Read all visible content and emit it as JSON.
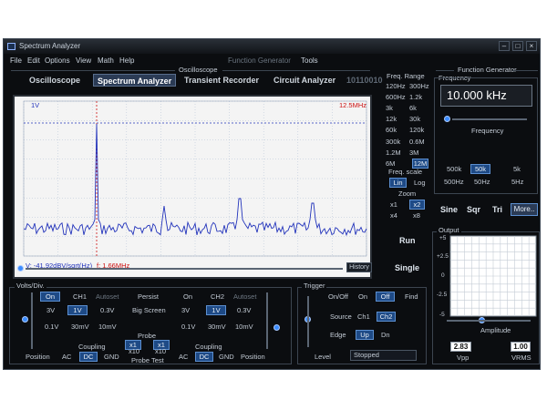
{
  "window": {
    "title": "Spectrum Analyzer",
    "min": "–",
    "max": "□",
    "close": "×"
  },
  "menu": {
    "file": "File",
    "edit": "Edit",
    "options": "Options",
    "view": "View",
    "math": "Math",
    "help": "Help",
    "function_generator": "Function Generator",
    "tools": "Tools"
  },
  "section_labels": {
    "oscilloscope": "Oscilloscope",
    "function_generator": "Function Generator",
    "frequency": "Frequency"
  },
  "tabs": {
    "oscilloscope": "Oscilloscope",
    "spectrum_analyzer": "Spectrum Analyzer",
    "transient_recorder": "Transient Recorder",
    "circuit_analyzer": "Circuit Analyzer",
    "binary": "10110010"
  },
  "display": {
    "top_left": "1V",
    "top_right": "12.5MHz",
    "cursor_readout": "V: -41.92dBV/sqrt(Hz)",
    "freq_readout": "f: 1.66MHz",
    "history": "History"
  },
  "freq_range": {
    "label": "Freq. Range",
    "options": [
      "120Hz",
      "300Hz",
      "600Hz",
      "1.2k",
      "3k",
      "6k",
      "12k",
      "30k",
      "60k",
      "120k",
      "300k",
      "0.6M",
      "1.2M",
      "3M",
      "6M",
      "12M"
    ],
    "selected": "12M"
  },
  "freq_scale": {
    "label": "Freq. scale",
    "lin": "Lin",
    "log": "Log",
    "selected": "Lin"
  },
  "zoom": {
    "label": "Zoom",
    "x1": "x1",
    "x2": "x2",
    "x4": "x4",
    "x8": "x8",
    "selected": "x2"
  },
  "run": "Run",
  "single": "Single",
  "function_generator": {
    "frequency_value": "10.000 kHz",
    "slider_label": "Frequency",
    "presets": [
      "500k",
      "50k",
      "5k",
      "500Hz",
      "50Hz",
      "5Hz"
    ],
    "selected_preset": "50k",
    "waves": {
      "sine": "Sine",
      "sqr": "Sqr",
      "tri": "Tri",
      "more": "More.."
    },
    "output_label": "Output",
    "amplitude_label": "Amplitude",
    "y_ticks": [
      "+5",
      "+2.5",
      "0",
      "-2.5",
      "-5"
    ],
    "vpp_value": "2.83",
    "vpp_label": "Vpp",
    "vrms_value": "1.00",
    "vrms_label": "VRMS"
  },
  "volts_div": {
    "label": "Volts/Div.",
    "ch1": {
      "on": "On",
      "name": "CH1",
      "autoset": "Autoset",
      "values": [
        "3V",
        "1V",
        "0.3V",
        "0.1V",
        "30mV",
        "10mV"
      ],
      "selected": "1V"
    },
    "ch2": {
      "on": "On",
      "name": "CH2",
      "autoset": "Autoset",
      "values": [
        "3V",
        "1V",
        "0.3V",
        "0.1V",
        "30mV",
        "10mV"
      ],
      "selected": "1V"
    },
    "persist": "Persist",
    "big_screen": "Big Screen",
    "probe": {
      "label": "Probe",
      "x1": "x1",
      "x10": "x10",
      "x1b": "x1",
      "x10b": "x10",
      "test": "Probe Test"
    },
    "position": "Position",
    "position2": "Position",
    "coupling": {
      "label": "Coupling",
      "ac": "AC",
      "dc": "DC",
      "gnd": "GND",
      "selected": "DC"
    },
    "coupling2": {
      "label": "Coupling",
      "ac": "AC",
      "dc": "DC",
      "gnd": "GND",
      "selected": "DC"
    }
  },
  "trigger": {
    "label": "Trigger",
    "onoff": "On/Off",
    "on": "On",
    "off": "Off",
    "find": "Find",
    "source": "Source",
    "ch1": "Ch1",
    "ch2": "Ch2",
    "edge": "Edge",
    "up": "Up",
    "dn": "Dn",
    "level": "Level",
    "status": "Stopped"
  },
  "colors": {
    "accent": "#1e4a86",
    "trace": "#2233bb",
    "marker": "#cc1111",
    "grid": "#88a0c0"
  }
}
